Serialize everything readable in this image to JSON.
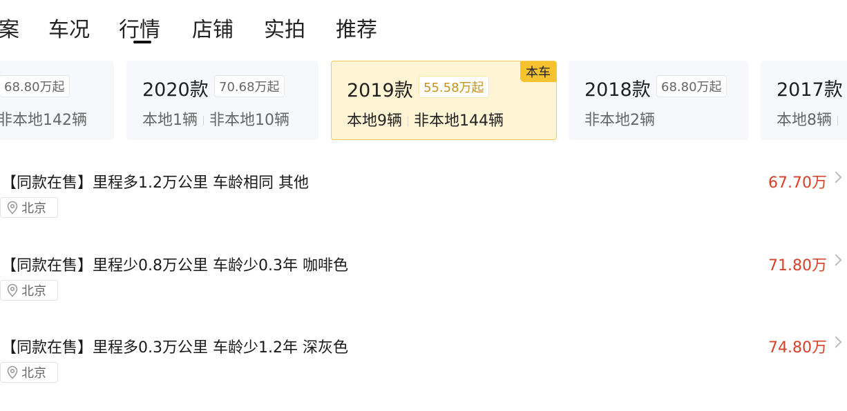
{
  "tabs": [
    {
      "label": "案"
    },
    {
      "label": "车况"
    },
    {
      "label": "行情",
      "active": true
    },
    {
      "label": "店铺"
    },
    {
      "label": "实拍"
    },
    {
      "label": "推荐"
    }
  ],
  "cards": [
    {
      "price": "68.80万起",
      "stock": [
        "非本地142辆"
      ]
    },
    {
      "year": "2020款",
      "price": "70.68万起",
      "stock": [
        "本地1辆",
        "非本地10辆"
      ]
    },
    {
      "year": "2019款",
      "price": "55.58万起",
      "stock": [
        "本地9辆",
        "非本地144辆"
      ],
      "badge": "本车",
      "active": true
    },
    {
      "year": "2018款",
      "price": "68.80万起",
      "stock": [
        "非本地2辆"
      ]
    },
    {
      "year": "2017款",
      "stock": [
        "本地8辆"
      ]
    }
  ],
  "listings": [
    {
      "title": "【同款在售】里程多1.2万公里 车龄相同 其他",
      "location": "北京",
      "price": "67.70万"
    },
    {
      "title": "【同款在售】里程少0.8万公里 车龄少0.3年 咖啡色",
      "location": "北京",
      "price": "71.80万"
    },
    {
      "title": "【同款在售】里程多0.3万公里 车龄少1.2年 深灰色",
      "location": "北京",
      "price": "74.80万"
    }
  ],
  "colors": {
    "accent_price": "#d9402a",
    "active_card_bg": "#fff4d3",
    "badge": "#f7c22f"
  },
  "icons": {
    "location": "location-pin-icon",
    "chevron": "chevron-right-icon"
  }
}
